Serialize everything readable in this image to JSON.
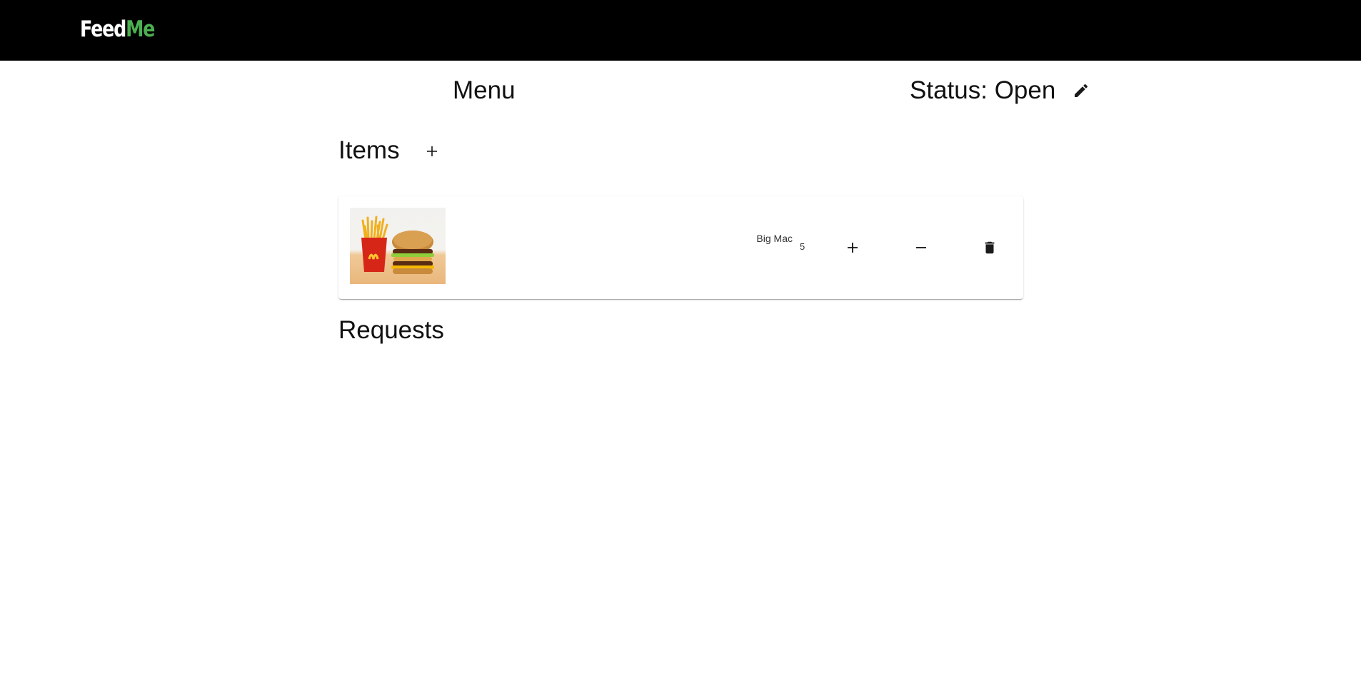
{
  "brand": {
    "part1": "Feed",
    "part2": "Me",
    "accent": "#4caf50"
  },
  "header": {
    "menu_title": "Menu",
    "status_label": "Status:",
    "status_value": "Open",
    "edit_icon": "pencil-icon"
  },
  "items_section": {
    "title": "Items",
    "add_icon": "plus-icon",
    "items": [
      {
        "image": "burger-and-fries-photo",
        "name": "Big Mac",
        "quantity": "5",
        "increment_icon": "plus-icon",
        "decrement_icon": "minus-icon",
        "delete_icon": "trash-icon"
      }
    ]
  },
  "requests_section": {
    "title": "Requests"
  }
}
